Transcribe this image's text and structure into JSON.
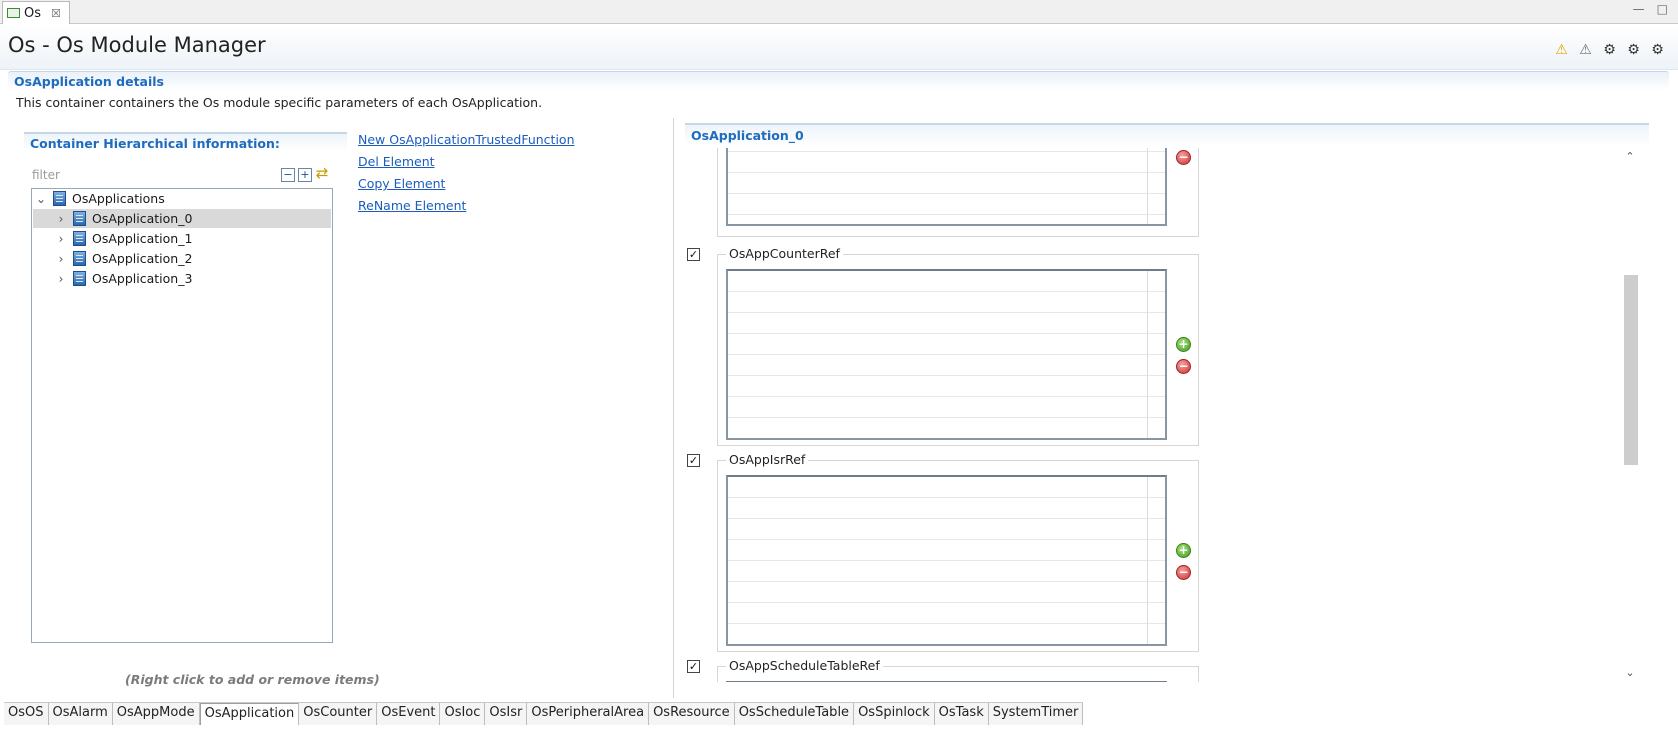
{
  "editor": {
    "tab_label": "Os",
    "close_glyph": "☒",
    "window_controls": [
      "—",
      "□"
    ]
  },
  "header": {
    "title": "Os - Os Module Manager",
    "icons": [
      "warning-icon",
      "error-filter-icon",
      "validate-icon",
      "generate-icon",
      "settings-icon"
    ]
  },
  "section": {
    "title": "OsApplication details",
    "description": "This container containers the Os module specific parameters of each OsApplication."
  },
  "hierarchy": {
    "title": "Container Hierarchical information:",
    "filter_placeholder": "filter",
    "root": "OsApplications",
    "items": [
      "OsApplication_0",
      "OsApplication_1",
      "OsApplication_2",
      "OsApplication_3"
    ],
    "selected": "OsApplication_0",
    "hint": "(Right click to add or remove items)"
  },
  "actions": {
    "new_trusted": "New OsApplicationTrustedFunction",
    "del": "Del Element",
    "copy": "Copy Element",
    "rename": "ReName Element"
  },
  "detail": {
    "title": "OsApplication_0",
    "groups": [
      {
        "label": "",
        "checked": true
      },
      {
        "label": "OsAppCounterRef",
        "checked": true
      },
      {
        "label": "OsAppIsrRef",
        "checked": true
      },
      {
        "label": "OsAppScheduleTableRef",
        "checked": true
      }
    ]
  },
  "bottom_tabs": {
    "items": [
      "OsOS",
      "OsAlarm",
      "OsAppMode",
      "OsApplication",
      "OsCounter",
      "OsEvent",
      "OsIoc",
      "OsIsr",
      "OsPeripheralArea",
      "OsResource",
      "OsScheduleTable",
      "OsSpinlock",
      "OsTask",
      "SystemTimer"
    ],
    "active": "OsApplication"
  },
  "colors": {
    "accent": "#1f6bbd",
    "link": "#1a5dbe",
    "selection": "#d9d9d9"
  }
}
